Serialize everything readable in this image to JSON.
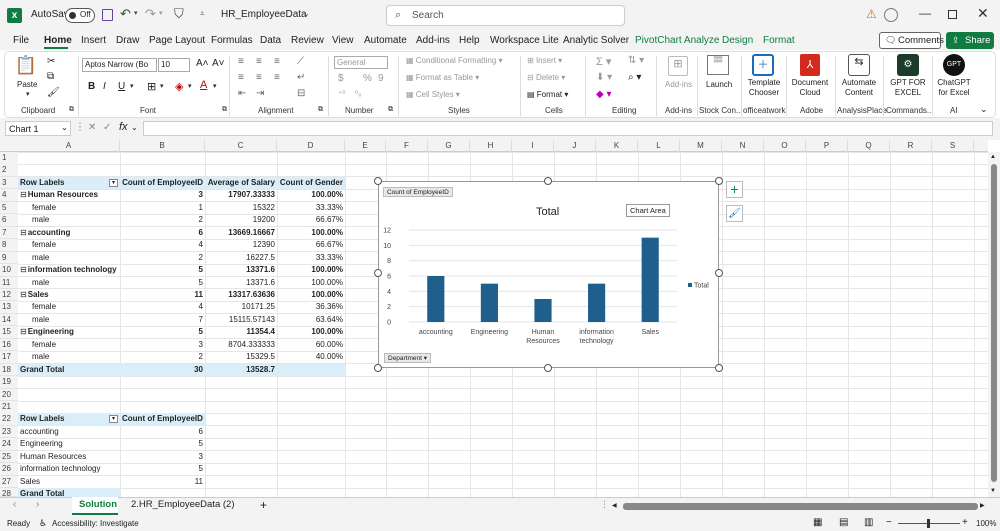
{
  "app": {
    "autosave_label": "AutoSave",
    "autosave_state": "Off",
    "filename": "HR_EmployeeData",
    "search_placeholder": "Search",
    "comments_label": "Comments",
    "share_label": "Share"
  },
  "menu": [
    "File",
    "Home",
    "Insert",
    "Draw",
    "Page Layout",
    "Formulas",
    "Data",
    "Review",
    "View",
    "Automate",
    "Add-ins",
    "Help",
    "Workspace Lite",
    "Analytic Solver",
    "PivotChart Analyze",
    "Design",
    "Format"
  ],
  "ribbon": {
    "paste": "Paste",
    "clipboard": "Clipboard",
    "font_name": "Aptos Narrow (Bo",
    "font_size": "10",
    "font": "Font",
    "alignment": "Alignment",
    "number_format": "General",
    "number": "Number",
    "conditional_formatting": "Conditional Formatting",
    "format_as_table": "Format as Table",
    "cell_styles": "Cell Styles",
    "styles": "Styles",
    "insert": "Insert",
    "delete": "Delete",
    "format": "Format",
    "cells": "Cells",
    "editing": "Editing",
    "addins_btn": "Add-ins",
    "addins_group": "Add-ins",
    "launch": "Launch",
    "stock_group": "Stock Con...",
    "template_chooser": "Template Chooser",
    "officeatwork": "officeatwork",
    "document_cloud": "Document Cloud",
    "adobe": "Adobe",
    "automate_content": "Automate Content",
    "analysisplace": "AnalysisPlace",
    "gpt_for_excel": "GPT FOR EXCEL",
    "commands": "Commands...",
    "chatgpt_for_excel": "ChatGPT for Excel",
    "ai": "AI"
  },
  "formula_bar": {
    "name_box": "Chart 1",
    "formula": ""
  },
  "columns": [
    "A",
    "B",
    "C",
    "D",
    "E",
    "F",
    "G",
    "H",
    "I",
    "J",
    "K",
    "L",
    "M",
    "N",
    "O",
    "P",
    "Q",
    "R",
    "S"
  ],
  "rows": [
    "1",
    "2",
    "3",
    "4",
    "5",
    "6",
    "7",
    "8",
    "9",
    "10",
    "11",
    "12",
    "13",
    "14",
    "15",
    "16",
    "17",
    "18",
    "19",
    "20",
    "21",
    "22",
    "23",
    "24",
    "25",
    "26",
    "27",
    "28"
  ],
  "pivot1": {
    "headers": [
      "Row Labels",
      "Count of EmployeeID",
      "Average of Salary",
      "Count of Gender"
    ],
    "rows": [
      {
        "label": "Human Resources",
        "count": "3",
        "avg": "17907.33333",
        "pct": "100.00%",
        "level": 0
      },
      {
        "label": "female",
        "count": "1",
        "avg": "15322",
        "pct": "33.33%",
        "level": 1
      },
      {
        "label": "male",
        "count": "2",
        "avg": "19200",
        "pct": "66.67%",
        "level": 1
      },
      {
        "label": "accounting",
        "count": "6",
        "avg": "13669.16667",
        "pct": "100.00%",
        "level": 0
      },
      {
        "label": "female",
        "count": "4",
        "avg": "12390",
        "pct": "66.67%",
        "level": 1
      },
      {
        "label": "male",
        "count": "2",
        "avg": "16227.5",
        "pct": "33.33%",
        "level": 1
      },
      {
        "label": "information technology",
        "count": "5",
        "avg": "13371.6",
        "pct": "100.00%",
        "level": 0
      },
      {
        "label": "male",
        "count": "5",
        "avg": "13371.6",
        "pct": "100.00%",
        "level": 1
      },
      {
        "label": "Sales",
        "count": "11",
        "avg": "13317.63636",
        "pct": "100.00%",
        "level": 0
      },
      {
        "label": "female",
        "count": "4",
        "avg": "10171.25",
        "pct": "36.36%",
        "level": 1
      },
      {
        "label": "male",
        "count": "7",
        "avg": "15115.57143",
        "pct": "63.64%",
        "level": 1
      },
      {
        "label": "Engineering",
        "count": "5",
        "avg": "11354.4",
        "pct": "100.00%",
        "level": 0
      },
      {
        "label": "female",
        "count": "3",
        "avg": "8704.333333",
        "pct": "60.00%",
        "level": 1
      },
      {
        "label": "male",
        "count": "2",
        "avg": "15329.5",
        "pct": "40.00%",
        "level": 1
      }
    ],
    "grand_total": {
      "label": "Grand Total",
      "count": "30",
      "avg": "13528.7",
      "pct": ""
    }
  },
  "pivot2": {
    "headers": [
      "Row Labels",
      "Count of EmployeeID"
    ],
    "rows": [
      {
        "label": "accounting",
        "count": "6"
      },
      {
        "label": "Engineering",
        "count": "5"
      },
      {
        "label": "Human Resources",
        "count": "3"
      },
      {
        "label": "information technology",
        "count": "5"
      },
      {
        "label": "Sales",
        "count": "11"
      }
    ],
    "grand_total_label": "Grand Total"
  },
  "chart_data": {
    "type": "bar",
    "title": "Total",
    "field_button": "Count of EmployeeID",
    "axis_field_button": "Department",
    "tooltip": "Chart Area",
    "categories": [
      "accounting",
      "Engineering",
      "Human Resources",
      "information technology",
      "Sales"
    ],
    "series": [
      {
        "name": "Total",
        "values": [
          6,
          5,
          3,
          5,
          11
        ],
        "color": "#1f5f8b"
      }
    ],
    "ylim": [
      0,
      12
    ],
    "yticks": [
      0,
      2,
      4,
      6,
      8,
      10,
      12
    ],
    "grid": true,
    "legend": "right"
  },
  "sheets": [
    "Solution",
    "2.HR_EmployeeData (2)"
  ],
  "status": {
    "ready": "Ready",
    "accessibility": "Accessibility: Investigate",
    "zoom": "100%"
  },
  "colors": {
    "accent": "#107c41",
    "pivot_header": "#d9eef9",
    "bar": "#1f5f8b"
  }
}
